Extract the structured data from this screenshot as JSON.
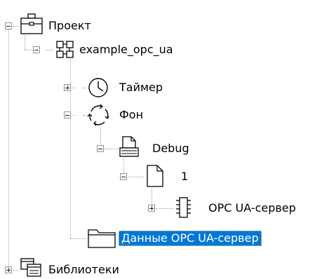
{
  "tree": {
    "project": {
      "label": "Проект",
      "state": "expanded",
      "icon": "briefcase-icon"
    },
    "app": {
      "label": "example_opc_ua",
      "state": "expanded",
      "icon": "network-nodes-icon"
    },
    "timer": {
      "label": "Таймер",
      "state": "collapsed",
      "icon": "clock-icon"
    },
    "background": {
      "label": "Фон",
      "state": "expanded",
      "icon": "cycle-arrows-icon"
    },
    "debug": {
      "label": "Debug",
      "state": "expanded",
      "icon": "stacked-document-icon"
    },
    "item1": {
      "label": "1",
      "state": "expanded",
      "icon": "document-icon"
    },
    "opc_server": {
      "label": "OPC UA-сервер",
      "state": "collapsed",
      "icon": "chip-icon"
    },
    "opc_data": {
      "label": "Данные OPC UA-сервер",
      "selected": true,
      "icon": "folder-icon"
    },
    "libraries": {
      "label": "Библиотеки",
      "state": "collapsed",
      "icon": "library-windows-icon"
    }
  },
  "colors": {
    "selection": "#0078d7",
    "focus_border": "#ffc870",
    "lines": "#a0a0a0"
  }
}
